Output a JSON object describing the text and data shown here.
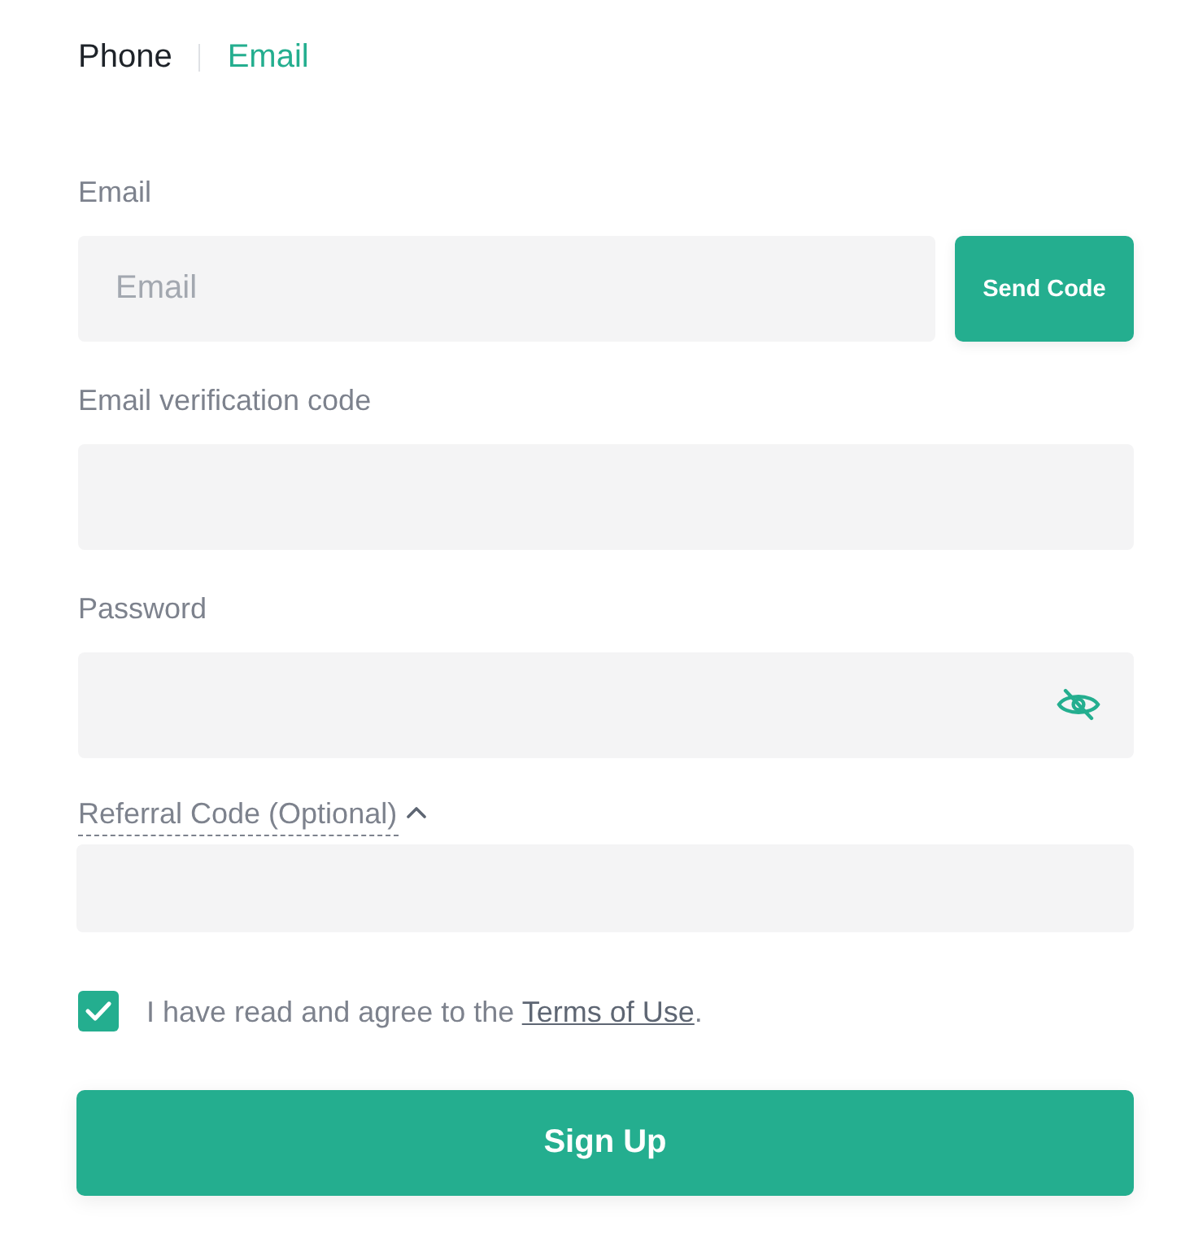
{
  "tabs": [
    {
      "label": "Phone",
      "selected": false
    },
    {
      "label": "Email",
      "selected": true
    }
  ],
  "fields": [
    {
      "kind": "email",
      "label": "Email",
      "placeholder": "Email",
      "button": "Send Code"
    },
    {
      "kind": "code",
      "label": "Email verification code"
    },
    {
      "kind": "password",
      "label": "Password",
      "hidden": true
    },
    {
      "kind": "referral",
      "label": "Referral Code (Optional)",
      "expanded": true
    }
  ],
  "agreement": {
    "checked": true,
    "text": "I have read and agree to the ",
    "link": "Terms of Use",
    "end": "."
  },
  "submit": {
    "label": "Sign Up"
  }
}
